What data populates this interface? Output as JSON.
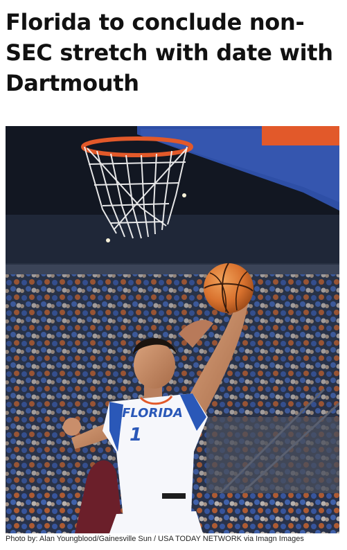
{
  "article": {
    "headline": "Florida to conclude non-SEC stretch with date with Dartmouth",
    "photo": {
      "jersey_text": "FLORIDA",
      "jersey_number": "1",
      "caption": "Photo by: Alan Youngblood/Gainesville Sun / USA TODAY NETWORK via Imagn Images"
    }
  },
  "colors": {
    "jersey_blue": "#2a58b8",
    "ball_orange": "#d9722e",
    "rim_orange": "#e2592a",
    "crowd_blue": "#3f63b8",
    "crowd_orange": "#d26b34"
  }
}
